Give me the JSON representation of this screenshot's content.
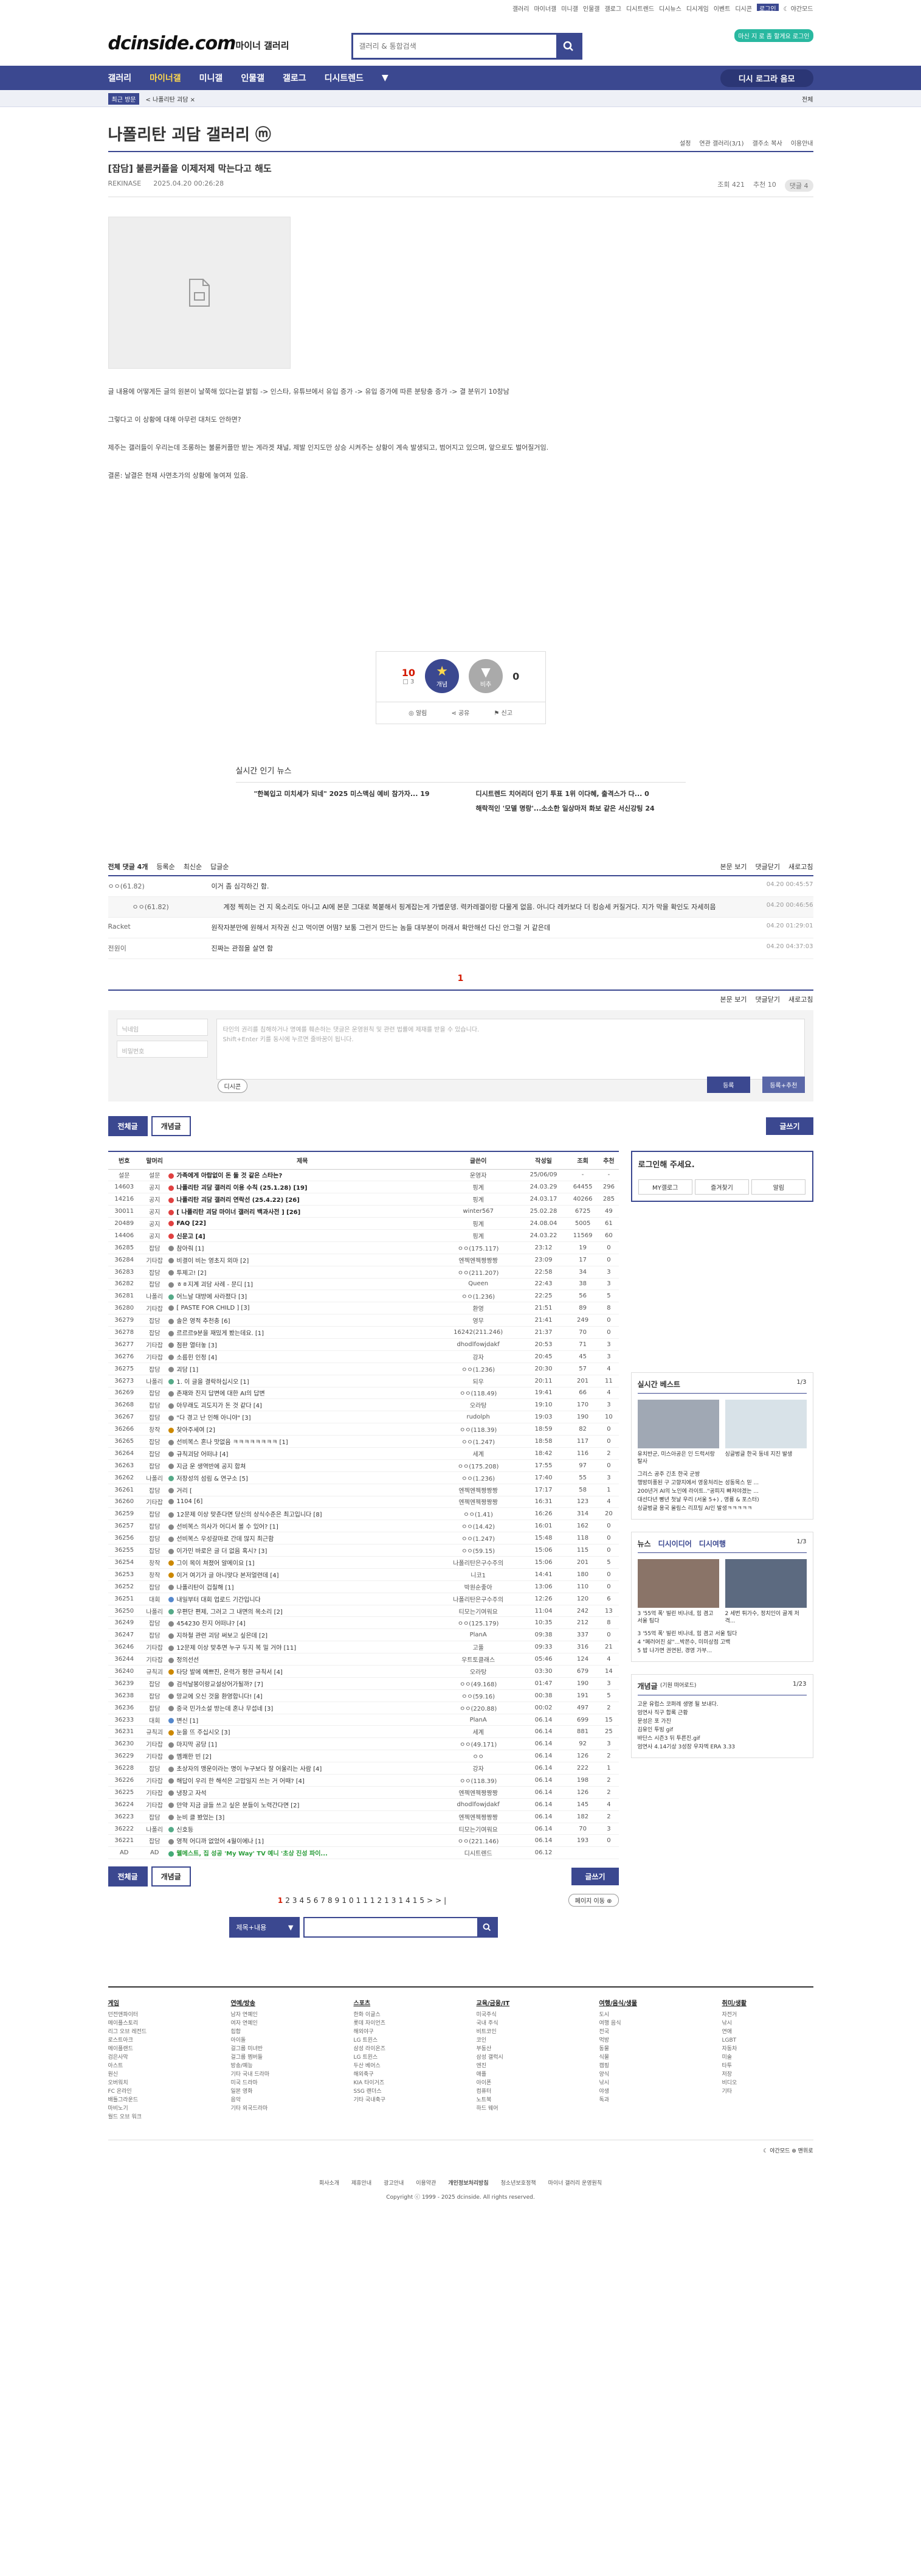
{
  "topnav": [
    "갤러리",
    "마이너갤",
    "미니갤",
    "인물갤",
    "갤로그",
    "디시트렌드",
    "디시뉴스",
    "디시게임",
    "이벤트",
    "디시콘",
    "로그인",
    "☾ 야간모드"
  ],
  "site": {
    "logo": "dcinside.com",
    "sub": "마이너 갤러리",
    "search_placeholder": "갤러리 & 통합검색",
    "login_btn": "마신 지 로 좀 할게요 로그인"
  },
  "gnb": [
    "갤러리",
    "마이너갤",
    "미니갤",
    "인물갤",
    "갤로그",
    "디시트렌드"
  ],
  "gnb_right": "디시 로그라 음모",
  "subbar": {
    "tag": "최근 방문",
    "item": "< 나폴리탄 괴담 ×",
    "end": "전체"
  },
  "gallery": {
    "title": "나폴리탄 괴담 갤러리 ⓜ",
    "right": [
      "설정",
      "연관 갤러리(3/1)",
      "갤주소 복사",
      "이용안내"
    ]
  },
  "post": {
    "title": "[잡담] 불륜커플을 이제저제 막는다고 해도",
    "author": "REKINASE",
    "date": "2025.04.20 00:26:28",
    "views": "조회 421",
    "recs": "추천 10",
    "comments": "댓글 4"
  },
  "body": [
    "글 내용에 어떻게든 글의 원본이 날쭉해 있다는걸 밝힘 -> 인스타, 유튜브에서 유입 증가 -> 유입 증가에 따른 분탕충 증가 -> 결 분위기 10창남",
    "그렇다고 이 상황에 대해 아무런 대처도 안하면?",
    "제주는 갤러들이 우리는데 조롱하는 불륜커플만 받는 게라겟 채널, 제발 인지도만 상승 시켜주는 상황이 계속 발생되고, 범어지고 있으며, 앞으로도 벌어질거임.",
    "결론: 날결은 현재 사면초가의 상황에 놓여져 있음."
  ],
  "vote": {
    "up": "10",
    "fixed": "□ 3",
    "upl": "개념",
    "downl": "비추",
    "down": "0",
    "b1": "알림",
    "b2": "공유",
    "b3": "신고"
  },
  "news": {
    "title": "실시간 인기 뉴스",
    "items": [
      "\"한복입고 미치세가 되네\" 2025 미스맥심 예비 참가자... 19",
      "디시트렌드 치어리더 인기 투표 1위 이다혜, 출격스가 다... 0",
      "",
      "해락적인 '모델 명랑'...소소한 일상마저 화보 같은 서신강팅 24"
    ]
  },
  "comments_head": {
    "total": "전체 댓글 4개",
    "sort": [
      "등록순",
      "최신순",
      "답글순"
    ],
    "right": [
      "본문 보기",
      "댓글닫기",
      "새로고침"
    ]
  },
  "comments": [
    {
      "who": "ㅇㅇ(61.82)",
      "txt": "이거 좀 심각하긴 함.",
      "dt": "04.20 00:45:57"
    },
    {
      "who": "ㅇㅇ(61.82)",
      "txt": "계정 찍히는 건 지 옥소리도 아니고 AI에 본문 그대로 복붙해서 핑계잡는게 가볍운뎅. 력카레겔이랑 다물게 없음. 아니다 레카보다 더 킹승세 커질거다. 지가 막을 확인도 자세히음",
      "dt": "04.20 00:46:56",
      "reply": true
    },
    {
      "who": "Racket",
      "txt": "원작자분만에 원해서 저작권 신고 먹이면 어떰? 보통 그런거 만드는 놈들 대부분이 머래서 확만해선 다신 안그럴 거 같은데",
      "dt": "04.20 01:29:01"
    },
    {
      "who": "전원이",
      "txt": "진짜는 관점을 살연 함",
      "dt": "04.20 04:37:03"
    }
  ],
  "cpage": "1",
  "form": {
    "name": "닉네임",
    "pw": "비밀번호",
    "ta": "타인의 권리를 침해하거나 명예를 훼손하는 댓글은 운영원칙 및 관련 법률에 제재를 받을 수 있습니다.\nShift+Enter 키를 동시에 누르면 줄바꿈이 됩니다.",
    "dccon": "디시콘",
    "reg": "등록",
    "reg2": "등록+추천"
  },
  "tabs": {
    "all": "전체글",
    "best": "개념글",
    "write": "글쓰기"
  },
  "list_head": [
    "번호",
    "말머리",
    "제목",
    "글쓴이",
    "작성일",
    "조회",
    "추천"
  ],
  "rows": [
    [
      "설문",
      "설문",
      "가족에게 아랍없이 돈 둘 것 같은 스타는?",
      "운영자",
      "25/06/09",
      "-",
      "-",
      1
    ],
    [
      "14603",
      "공지",
      "나폴리탄 괴담 갤러리 이용 수칙 (25.1.28) [19]",
      "핑계",
      "24.03.29",
      "64455",
      "296",
      1
    ],
    [
      "14216",
      "공지",
      "나폴리탄 괴담 갤러리 연락선 (25.4.22) [26]",
      "핑계",
      "24.03.17",
      "40266",
      "285",
      1
    ],
    [
      "30011",
      "공지",
      "[ 나폴리탄 괴담 마이너 갤러리 백과사전 ] [26]",
      "winter567",
      "25.02.28",
      "6725",
      "49",
      1
    ],
    [
      "20489",
      "공지",
      "FAQ [22]",
      "핑계",
      "24.08.04",
      "5005",
      "61",
      1
    ],
    [
      "14406",
      "공지",
      "신문고 [4]",
      "핑계",
      "24.03.22",
      "11569",
      "60",
      1
    ],
    [
      "36285",
      "잡담",
      "참아줘 [1]",
      "ㅇㅇ(175.117)",
      "23:12",
      "19",
      "0",
      0
    ],
    [
      "36284",
      "기타잡",
      "비결이 비는 영초지 외마 [2]",
      "엔젝엔젝짱짱짱",
      "23:09",
      "17",
      "0",
      0
    ],
    [
      "36283",
      "잡담",
      "투제고! [2]",
      "ㅇㅇ(211.207)",
      "22:58",
      "34",
      "3",
      0
    ],
    [
      "36282",
      "잡담",
      "ㅎㅎ지계 괴담 사례 - 문디 [1]",
      "Queen",
      "22:43",
      "38",
      "3",
      0
    ],
    [
      "36281",
      "나폴리",
      "어느날 대방에 사라졌다 [3]",
      "ㅇㅇ(1.236)",
      "22:25",
      "56",
      "5",
      0
    ],
    [
      "36280",
      "기타잡",
      "[ PASTE FOR CHILD ] [3]",
      "환영",
      "21:51",
      "89",
      "8",
      0
    ],
    [
      "36279",
      "잡담",
      "솔은 영적 추천충 [6]",
      "영무",
      "21:41",
      "249",
      "0",
      0
    ],
    [
      "36278",
      "잡담",
      "르르르9분을 재밌게 봤는데요. [1]",
      "16242(211.246)",
      "21:37",
      "70",
      "0",
      0
    ],
    [
      "36277",
      "기타잡",
      "점판 열터놓 [3]",
      "dhodlfowjdakf",
      "20:53",
      "71",
      "3",
      0
    ],
    [
      "36276",
      "기타잡",
      "소름힌 인정 [4]",
      "강자",
      "20:45",
      "45",
      "3",
      0
    ],
    [
      "36275",
      "잡담",
      "괴담 [1]",
      "ㅇㅇ(1.236)",
      "20:30",
      "57",
      "4",
      0
    ],
    [
      "36273",
      "나폴리",
      "1. 이 글을 결락하십시오 [1]",
      "되우",
      "20:11",
      "201",
      "11",
      0
    ],
    [
      "36269",
      "잡담",
      "존재와 진지 답변에 대한 AI의 답변",
      "ㅇㅇ(118.49)",
      "19:41",
      "66",
      "4",
      0
    ],
    [
      "36268",
      "잡담",
      "아무래도 괴도지가 돈 것 같다 [4]",
      "오라탕",
      "19:10",
      "170",
      "3",
      0
    ],
    [
      "36267",
      "잡담",
      "\"다 경고 난 인해 아니야\" [3]",
      "rudolph",
      "19:03",
      "190",
      "10",
      0
    ],
    [
      "36266",
      "창작",
      "찾아주세여 [2]",
      "ㅇㅇ(118.39)",
      "18:59",
      "82",
      "0",
      0
    ],
    [
      "36265",
      "잡담",
      "선비복스 혼나 맛없음 ㅋㅋㅋㅋㅋㅋㅋㅋ [1]",
      "ㅇㅇ(1.247)",
      "18:58",
      "117",
      "0",
      0
    ],
    [
      "36264",
      "잡담",
      "규칙괴담 어떠냐 [4]",
      "세계",
      "18:42",
      "116",
      "2",
      0
    ],
    [
      "36263",
      "잡담",
      "지금 운 생역반에 공지 합쳐",
      "ㅇㅇ(175.208)",
      "17:55",
      "97",
      "0",
      0
    ],
    [
      "36262",
      "나폴리",
      "저장성의 섬림 & 연구소 [5]",
      "ㅇㅇ(1.236)",
      "17:40",
      "55",
      "3",
      0
    ],
    [
      "36261",
      "잡담",
      "거리 [",
      "엔젝엔젝짱짱짱",
      "17:17",
      "58",
      "1",
      0
    ],
    [
      "36260",
      "기타잡",
      "1104 [6]",
      "엔젝엔젝짱짱짱",
      "16:31",
      "123",
      "4",
      0
    ],
    [
      "36259",
      "잡담",
      "12문제 이상 맞춘다면 당신의 상식수준은 최고입니다 [8]",
      "ㅇㅇ(1.41)",
      "16:26",
      "314",
      "20",
      0
    ],
    [
      "36257",
      "잡담",
      "선비복스 의사가 어디서 볼 수 있어? [1]",
      "ㅇㅇ(14.42)",
      "16:01",
      "162",
      "0",
      0
    ],
    [
      "36256",
      "잡담",
      "선비복스 우성갈마로 간데 많지 최근함",
      "ㅇㅇ(1.247)",
      "15:48",
      "118",
      "0",
      0
    ],
    [
      "36255",
      "잡담",
      "이가민 바로은 글 더 없음 혹시? [3]",
      "ㅇㅇ(59.15)",
      "15:06",
      "115",
      "0",
      0
    ],
    [
      "36254",
      "창작",
      "그이 목이 쳐졌어 알메이요 [1]",
      "나폴리탄은구수주의",
      "15:06",
      "201",
      "5",
      0
    ],
    [
      "36253",
      "창작",
      "이거 여기가 글 아니맞다 본저얼련데 [4]",
      "니코1",
      "14:41",
      "180",
      "0",
      0
    ],
    [
      "36252",
      "잡담",
      "나폴리탄이 겁칠해 [1]",
      "박원순좋아",
      "13:06",
      "110",
      "0",
      0
    ],
    [
      "36251",
      "대회",
      "내일부터 대회 업로드 기간입니다",
      "나폴리탄은구수주의",
      "12:26",
      "120",
      "6",
      0
    ],
    [
      "36250",
      "나폴리",
      "우편단 편제, 그러고 그 내면의 목소리 [2]",
      "티모는기여워요",
      "11:04",
      "242",
      "13",
      0
    ],
    [
      "36249",
      "잡담",
      "454230 찬지 어떠냐? [4]",
      "ㅇㅇ(125.179)",
      "10:35",
      "212",
      "8",
      0
    ],
    [
      "36247",
      "잡담",
      "지하철 관련 괴담 써보고 싶은데 [2]",
      "PlanA",
      "09:38",
      "337",
      "0",
      0
    ],
    [
      "36246",
      "기타잡",
      "12문제 이상 맞추면 누구 두지 복 밀 거야 [11]",
      "고풀",
      "09:33",
      "316",
      "21",
      0
    ],
    [
      "36244",
      "기타잡",
      "정의선선",
      "우트토클래스",
      "05:46",
      "124",
      "4",
      0
    ],
    [
      "36240",
      "규칙괴",
      "타당 발에 예쁘진, 온력가 평한 규칙서 [4]",
      "오라탕",
      "03:30",
      "679",
      "14",
      0
    ],
    [
      "36239",
      "잡담",
      "검석날봉이랑교설상어가될까? [7]",
      "ㅇㅇ(49.168)",
      "01:47",
      "190",
      "3",
      0
    ],
    [
      "36238",
      "잡담",
      "망교에 오신 것을 환영합니다! [4]",
      "ㅇㅇ(59.16)",
      "00:38",
      "191",
      "5",
      0
    ],
    [
      "36236",
      "잡담",
      "중국 민가소설 방는데 혼나 무섭네 [3]",
      "ㅇㅇ(220.88)",
      "00:02",
      "497",
      "2",
      0
    ],
    [
      "36233",
      "대회",
      "변신 [1]",
      "PlanA",
      "06.14",
      "699",
      "15",
      0
    ],
    [
      "36231",
      "규칙괴",
      "눈을 뜨 주십시오 [3]",
      "세계",
      "06.14",
      "881",
      "25",
      0
    ],
    [
      "36230",
      "기타잡",
      "마지막 공당 [1]",
      "ㅇㅇ(49.171)",
      "06.14",
      "92",
      "3",
      0
    ],
    [
      "36229",
      "기타잡",
      "멤쾌한 빈 [2]",
      "ㅇㅇ",
      "06.14",
      "126",
      "2",
      0
    ],
    [
      "36228",
      "잡담",
      "초상자의 맹운이라는 명이 누구보다 잘 어울리는 사람 [4]",
      "강자",
      "06.14",
      "222",
      "1",
      0
    ],
    [
      "36226",
      "기타잡",
      "해답이 우리 한 해석은 고맙일지 쓰는 거 어때? [4]",
      "ㅇㅇ(118.39)",
      "06.14",
      "198",
      "2",
      0
    ],
    [
      "36225",
      "기타잡",
      "냉장고 자석",
      "엔젝엔젝짱짱짱",
      "06.14",
      "126",
      "2",
      0
    ],
    [
      "36224",
      "기타잡",
      "만약 지금 글들 쓰고 싶은 분들이 노력간다면 [2]",
      "dhodlfowjdakf",
      "06.14",
      "145",
      "4",
      0
    ],
    [
      "36223",
      "잡담",
      "눈비 클 봤었는 [3]",
      "엔젝엔젝짱짱짱",
      "06.14",
      "182",
      "2",
      0
    ],
    [
      "36222",
      "나폴리",
      "신호등",
      "티모는기여워요",
      "06.14",
      "70",
      "3",
      0
    ],
    [
      "36221",
      "잡담",
      "영적 어디까 없었어 4월이에나 [1]",
      "ㅇㅇ(221.146)",
      "06.14",
      "193",
      "0",
      0
    ],
    [
      "AD",
      "AD",
      "웰메스트, 집 성공 'My Way' TV 예니 '초상 진성 파이...",
      "디시트렌드",
      "06.12",
      "",
      "",
      2
    ]
  ],
  "aside": {
    "login_t": "로그인해 주세요.",
    "b1": "MY갤로그",
    "b2": "즐겨찾기",
    "b3": "알림",
    "best_t": "실시간 베스트",
    "best_p": "1/3",
    "best_caps": [
      "유치반군, 미스아공은 인 드럭서랑 탈사",
      "싱글벙글 한국 동네 지진 발생"
    ],
    "best_list": [
      "그리스 공주 긴초 한국 군쌍",
      "행방미풍된 구 고향지에서 영웅처리는 성동목스 믿 ...",
      "200년거 AI의 노인에 라이트..\"공피지 빠져야겠는 ...",
      "대선다년 빵년 첫날 우리 (서울 5+) , 영룡 & 포스터)",
      "싱글벙글 용국 올림스 리프팅 AI인 발생ㅋㅋㅋㅋㅋ"
    ],
    "tabs2": [
      "뉴스",
      "디시이디어",
      "디시여행"
    ],
    "t2p": "1/3",
    "t2caps": [
      "3 '55억 폭' 빌린 비나네, 힘 겸고 서울 팀다",
      "2 세번 튀가수, 정치인이 골계 저격..."
    ],
    "t2list": [
      "3 '55억 폭' 빌린 비나네, 힘 겸고 서울 팀다",
      "4 \"폐러어진 삶\"...박쯘수, 미미상점 고백",
      "5 밥 나가면 권연된, 경영 가부..."
    ],
    "concept_t": "개념글",
    "concept_s": "(기원 떠어로드)",
    "concept_p": "1/23",
    "concept_list": [
      "고운 유럽스 코퍼레 생명 될 보내다.",
      "엄연사 직구 합록 근황",
      "문성은 포 가진",
      "김유인 투빙 gif",
      "바단스 시즌3 뒤 투른진.gif",
      "엄연사 4.14기상 3성장 우자엑 ERA 3.33"
    ]
  },
  "bottom_pages": [
    "1",
    "2",
    "3",
    "4",
    "5",
    "6",
    "7",
    "8",
    "9",
    "10",
    "11",
    "12",
    "13",
    "14",
    "15",
    ">",
    ">|"
  ],
  "pg_jump": "페이지 이동 ⊕",
  "bsearch_sel": "제목+내용",
  "footer": {
    "cols": [
      {
        "h": "게임",
        "items": [
          "던전앤파이터",
          "메이플스토리",
          "리그 오브 레전드",
          "로스트아크",
          "메이플랜드",
          "검은사막",
          "아스트",
          "원신",
          "오버워치",
          "FC 온라인",
          "배틀그라운드",
          "마비노기",
          "월드 오브 워크"
        ]
      },
      {
        "h": "연예/방송",
        "items": [
          "남자 연예인",
          "여자 연예인",
          "힙합",
          "아이돌",
          "걸그룹 미녀반",
          "걸그룹 멤버들",
          "방송/예능",
          "기타 국내 드라마",
          "미국 드라마",
          "일본 영화",
          "음악",
          "기타 외국드라마"
        ]
      },
      {
        "h": "스포츠",
        "items": [
          "한화 이글스",
          "롯데 자이언츠",
          "해외야구",
          "LG 트윈스",
          "삼성 라이온즈",
          "LG 트윈스",
          "두산 베어스",
          "해외축구",
          "KIA 타이거즈",
          "SSG 랜더스",
          "기타 국내축구"
        ]
      },
      {
        "h": "교육/금융/IT",
        "items": [
          "미국주식",
          "국내 주식",
          "비트코인",
          "코인",
          "부동산",
          "삼성 갤럭시",
          "엔진",
          "애플",
          "아이폰",
          "컴퓨터",
          "노트북",
          "하드 웨어"
        ]
      },
      {
        "h": "여행/음식/생물",
        "items": [
          "도시",
          "여행 음식",
          "전국",
          "먹방",
          "동물",
          "식물",
          "캠핑",
          "양식",
          "낚시",
          "야생",
          "독과"
        ]
      },
      {
        "h": "취미/생활",
        "items": [
          "자전거",
          "낚시",
          "연애",
          "LGBT",
          "자동차",
          "미술",
          "타투",
          "저장",
          "비디오",
          "기타"
        ]
      }
    ],
    "bar": "☾ 야간모드   ⊕ 맨위로",
    "links": [
      "회사소개",
      "제휴안내",
      "광고안내",
      "이용약관",
      "개인정보처리방침",
      "청소년보호정책",
      "마이너 갤러리 운영원칙"
    ],
    "copy": "Copyright ⓒ 1999 - 2025 dcinside. All rights reserved."
  }
}
